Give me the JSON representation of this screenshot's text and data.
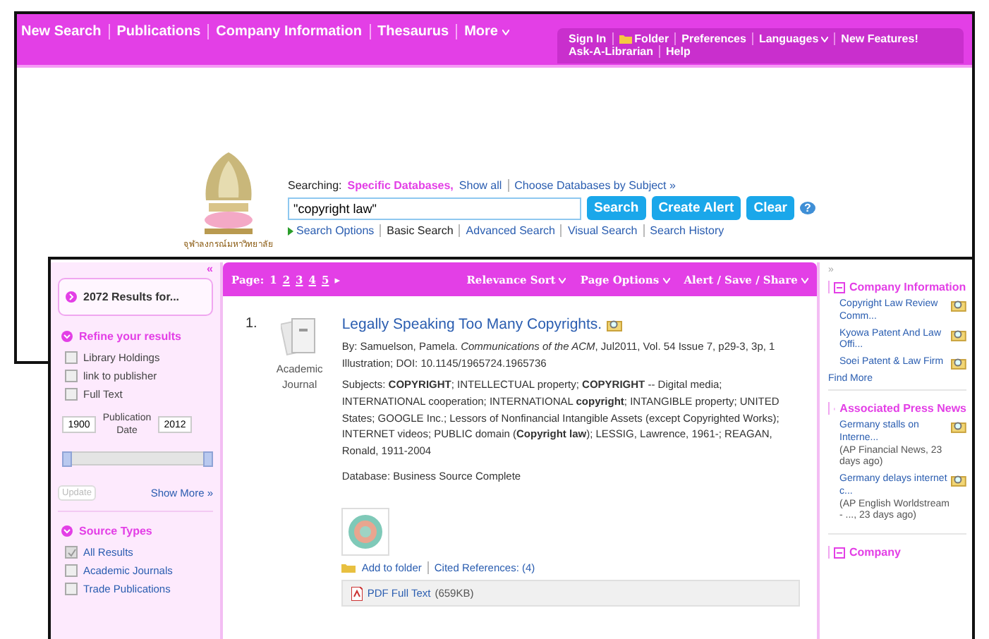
{
  "back_window": {
    "nav": [
      {
        "label": "New Search",
        "caret": false
      },
      {
        "label": "Publications",
        "caret": false
      },
      {
        "label": "Company Information",
        "caret": false
      },
      {
        "label": "Thesaurus",
        "caret": false
      },
      {
        "label": "More",
        "caret": true
      }
    ],
    "account_links": [
      {
        "label": "Sign In",
        "kind": "plain",
        "caret": false
      },
      {
        "label": "Folder",
        "kind": "folder",
        "caret": false
      },
      {
        "label": "Preferences",
        "kind": "plain",
        "caret": false
      },
      {
        "label": "Languages",
        "kind": "plain",
        "caret": true
      },
      {
        "label": "New Features!",
        "kind": "plain",
        "caret": false
      }
    ],
    "account_links_row2": [
      "Ask-A-Librarian",
      "Help"
    ],
    "logo_caption": "จุฬาลงกรณ์มหาวิทยาลัย",
    "searching_label": "Searching:",
    "searching_value": "Specific Databases,",
    "show_all": "Show all",
    "choose_databases": "Choose Databases by Subject »",
    "search_value": "\"copyright law\"",
    "buttons": [
      "Search",
      "Create Alert",
      "Clear"
    ],
    "help": "?",
    "search_links": [
      {
        "label": "Search Options",
        "selected": false,
        "arrow": true
      },
      {
        "label": "Basic Search",
        "selected": true,
        "arrow": false
      },
      {
        "label": "Advanced Search",
        "selected": false,
        "arrow": false
      },
      {
        "label": "Visual Search",
        "selected": false,
        "arrow": false
      },
      {
        "label": "Search History",
        "selected": false,
        "arrow": false
      }
    ]
  },
  "front_window": {
    "sidebar": {
      "collapse": "«",
      "results": "2072 Results for...",
      "refine_title": "Refine your results",
      "refine_options": [
        {
          "label": "Library Holdings",
          "checked": false
        },
        {
          "label": "link to publisher",
          "checked": false
        },
        {
          "label": "Full Text",
          "checked": false
        }
      ],
      "date_range": {
        "level": 1
      },
      "date_from": "1900",
      "date_label": "Publication Date",
      "date_to": "2012",
      "update": "Update",
      "update_disabled": true,
      "show_more": "Show More »",
      "source_title": "Source Types",
      "source_options": [
        {
          "label": "All Results",
          "checked": true
        },
        {
          "label": "Academic Journals",
          "checked": false
        },
        {
          "label": "Trade Publications",
          "checked": false
        }
      ]
    },
    "toolbar": {
      "page_label": "Page:",
      "pages": [
        {
          "label": "1",
          "selected": true
        },
        {
          "label": "2",
          "selected": false
        },
        {
          "label": "3",
          "selected": false
        },
        {
          "label": "4",
          "selected": false
        },
        {
          "label": "5",
          "selected": false
        }
      ],
      "next": "▸",
      "menus": [
        "Relevance Sort",
        "Page Options",
        "Alert / Save / Share"
      ]
    },
    "result": {
      "number": "1.",
      "type": "Academic Journal",
      "title": "Legally Speaking Too Many Copyrights.",
      "byline": "By: Samuelson, Pamela. *Communications of the ACM*, Jul2011, Vol. 54 Issue 7, p29-3, 3p, 1 Illustration; DOI: 10.1145/1965724.1965736",
      "subjects": "Subjects: **COPYRIGHT**; INTELLECTUAL property; **COPYRIGHT** -- Digital media; INTERNATIONAL cooperation; INTERNATIONAL **copyright**; INTANGIBLE property; UNITED States; GOOGLE Inc.; Lessors of Nonfinancial Intangible Assets (except Copyrighted Works); INTERNET videos; PUBLIC domain (**Copyright law**); LESSIG, Lawrence, 1961-; REAGAN, Ronald, 1911-2004",
      "database": "Database: Business Source Complete",
      "add_to_folder": "Add to folder",
      "cited": "Cited References: (4)",
      "pdf": "PDF Full Text",
      "pdf_size": "(659KB)"
    },
    "right": {
      "expand": "»",
      "sections": [
        {
          "title": "Company Information",
          "items": [
            {
              "link": "Copyright Law Review Comm..."
            },
            {
              "link": "Kyowa Patent And Law Offi..."
            },
            {
              "link": "Soei Patent & Law Firm"
            }
          ],
          "more": "Find More"
        },
        {
          "title": "Associated Press News",
          "items": [
            {
              "link": "Germany stalls on Interne...",
              "source": "(AP Financial News, 23 days ago)"
            },
            {
              "link": "Germany delays internet c...",
              "source": "(AP English Worldstream - ..., 23 days ago)"
            }
          ]
        },
        {
          "title": "Company"
        }
      ]
    }
  }
}
